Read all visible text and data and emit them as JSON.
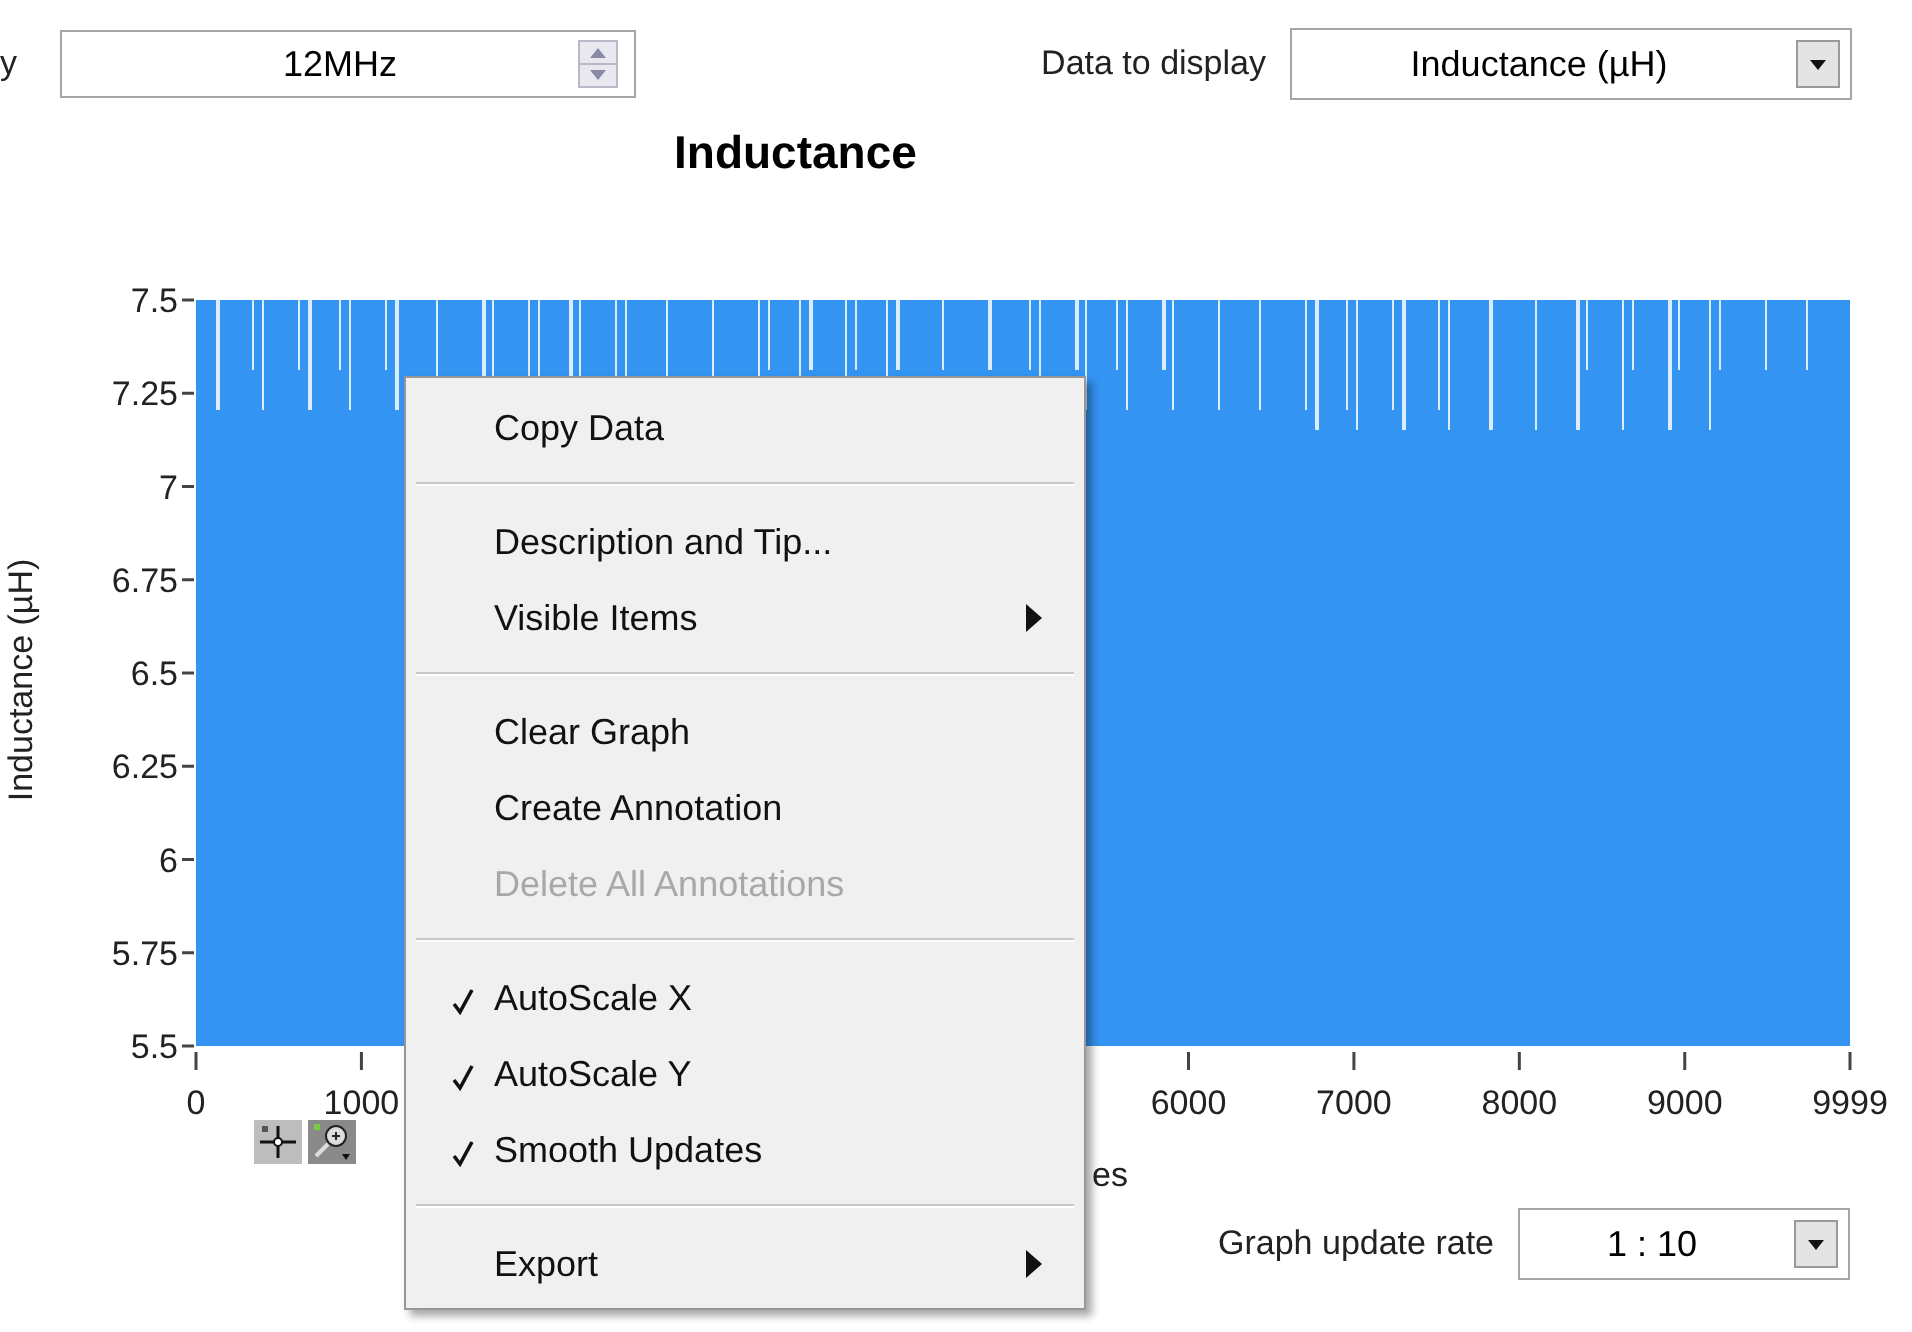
{
  "frequency_control": {
    "label": "y",
    "value": "12MHz"
  },
  "data_to_display": {
    "label": "Data to display",
    "value": "Inductance (µH)"
  },
  "graph": {
    "title": "Inductance",
    "y_axis_label": "Inductance (µH)",
    "x_axis_label": "es",
    "y_ticks": [
      "7.5",
      "7.25",
      "7",
      "6.75",
      "6.5",
      "6.25",
      "6",
      "5.75",
      "5.5"
    ],
    "x_ticks": [
      "0",
      "1000",
      "6000",
      "7000",
      "8000",
      "9000",
      "9999"
    ]
  },
  "context_menu": {
    "items": [
      {
        "kind": "item",
        "label": "Copy Data",
        "checked": false,
        "disabled": false,
        "submenu": false
      },
      {
        "kind": "separator"
      },
      {
        "kind": "item",
        "label": "Description and Tip...",
        "checked": false,
        "disabled": false,
        "submenu": false
      },
      {
        "kind": "item",
        "label": "Visible Items",
        "checked": false,
        "disabled": false,
        "submenu": true
      },
      {
        "kind": "separator"
      },
      {
        "kind": "item",
        "label": "Clear Graph",
        "checked": false,
        "disabled": false,
        "submenu": false
      },
      {
        "kind": "item",
        "label": "Create Annotation",
        "checked": false,
        "disabled": false,
        "submenu": false
      },
      {
        "kind": "item",
        "label": "Delete All Annotations",
        "checked": false,
        "disabled": true,
        "submenu": false
      },
      {
        "kind": "separator"
      },
      {
        "kind": "item",
        "label": "AutoScale X",
        "checked": true,
        "disabled": false,
        "submenu": false
      },
      {
        "kind": "item",
        "label": "AutoScale Y",
        "checked": true,
        "disabled": false,
        "submenu": false
      },
      {
        "kind": "item",
        "label": "Smooth Updates",
        "checked": true,
        "disabled": false,
        "submenu": false
      },
      {
        "kind": "separator"
      },
      {
        "kind": "item",
        "label": "Export",
        "checked": false,
        "disabled": false,
        "submenu": true
      }
    ]
  },
  "graph_update_rate": {
    "label": "Graph update rate",
    "value": "1 : 10"
  }
}
